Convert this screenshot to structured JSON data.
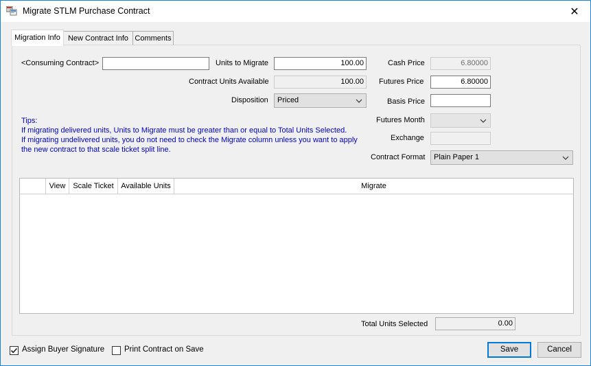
{
  "window": {
    "title": "Migrate STLM Purchase Contract",
    "close_glyph": "✕"
  },
  "tabs": [
    {
      "label": "Migration Info"
    },
    {
      "label": "New Contract Info"
    },
    {
      "label": "Comments"
    }
  ],
  "form": {
    "consuming_contract_label": "<Consuming Contract>",
    "consuming_contract_value": "",
    "units_to_migrate_label": "Units to Migrate",
    "units_to_migrate_value": "100.00",
    "contract_units_available_label": "Contract Units Available",
    "contract_units_available_value": "100.00",
    "disposition_label": "Disposition",
    "disposition_value": "Priced",
    "cash_price_label": "Cash Price",
    "cash_price_value": "6.80000",
    "futures_price_label": "Futures Price",
    "futures_price_value": "6.80000",
    "basis_price_label": "Basis Price",
    "basis_price_value": "",
    "futures_month_label": "Futures Month",
    "futures_month_value": "",
    "exchange_label": "Exchange",
    "exchange_value": "",
    "contract_format_label": "Contract Format",
    "contract_format_value": "Plain Paper 1"
  },
  "tips": {
    "title": "Tips:",
    "line1": "If migrating delivered units, Units to Migrate must be greater than or equal to Total Units Selected.",
    "line2": "If migrating undelivered units, you do not need to check the Migrate column unless you want to apply",
    "line3": "the new contract to that scale ticket split line."
  },
  "grid": {
    "columns": [
      "",
      "View",
      "Scale Ticket",
      "Available Units",
      "Migrate"
    ],
    "rows": []
  },
  "totals": {
    "label": "Total Units Selected",
    "value": "0.00"
  },
  "footer": {
    "assign_buyer_signature_label": "Assign Buyer Signature",
    "assign_buyer_signature_checked": true,
    "print_contract_label": "Print Contract on Save",
    "print_contract_checked": false,
    "save_label": "Save",
    "cancel_label": "Cancel"
  },
  "colors": {
    "accent": "#0078d7",
    "tips_text": "#0000c8",
    "window_border": "#1883d7"
  }
}
